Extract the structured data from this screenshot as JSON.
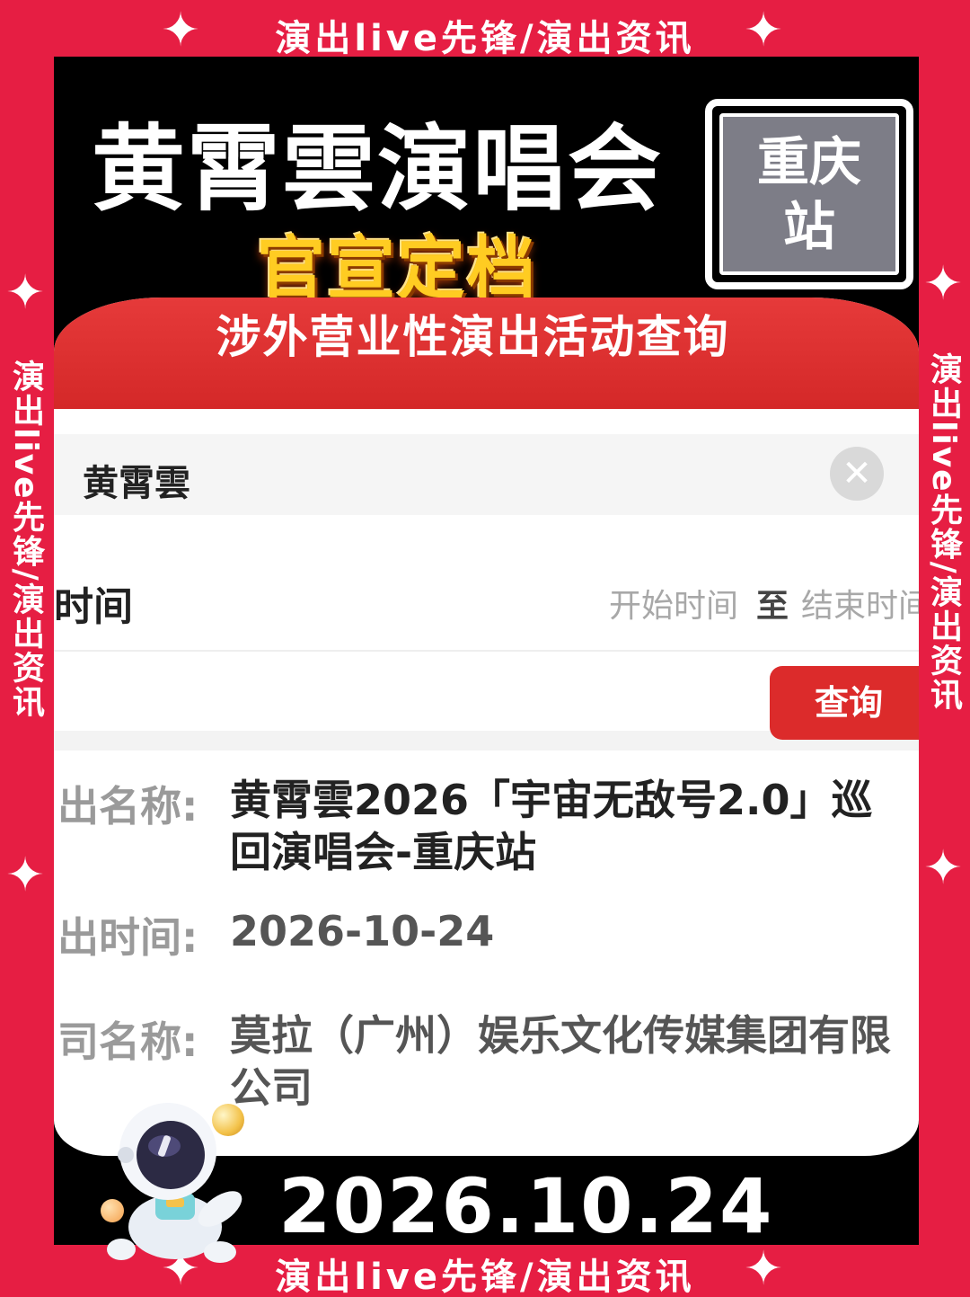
{
  "banner": {
    "top": "演出live先锋/演出资讯",
    "bottom": "演出live先锋/演出资讯",
    "left": "演出live先锋/演出资讯",
    "right": "演出live先锋/演出资讯",
    "sparkle_icon": "four-point-star",
    "frame_color": "#e61e43"
  },
  "poster": {
    "title": "黄霄雲演唱会",
    "subtitle": "官宣定档",
    "city_stamp": "重庆站",
    "date": "2026.10.24"
  },
  "app": {
    "header_title": "涉外营业性演出活动查询",
    "search": {
      "value": "黄霄雲",
      "clear_icon": "close-circle-icon"
    },
    "time_filter": {
      "label": "时间",
      "start_placeholder": "开始时间",
      "to": "至",
      "end_placeholder": "结束时间"
    },
    "query_button": "查询",
    "result": {
      "name_label": "出名称:",
      "name_value": "黄霄雲2026「宇宙无敌号2.0」巡回演唱会-重庆站",
      "time_label": "出时间:",
      "time_value": "2026-10-24",
      "company_label": "司名称:",
      "company_value": "莫拉（广州）娱乐文化传媒集团有限公司"
    },
    "accent_color": "#dc2b2b"
  }
}
